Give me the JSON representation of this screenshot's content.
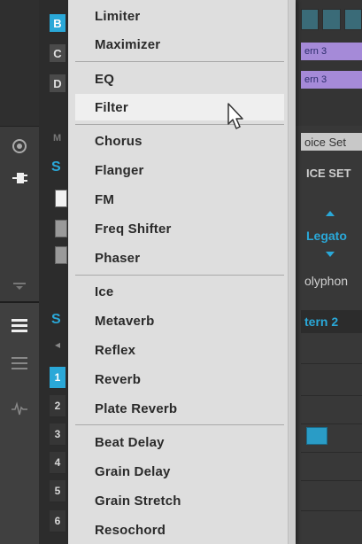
{
  "left_column": {
    "letters": [
      "B",
      "C",
      "D"
    ],
    "active_letter_index": 0,
    "group_label_1": "S",
    "group_label_2": "S",
    "section_m": "M",
    "numbers": [
      "1",
      "2",
      "3",
      "4",
      "5",
      "6"
    ],
    "active_number_index": 0
  },
  "right_panel": {
    "pattern_top_1": "ern 3",
    "pattern_top_2": "ern 3",
    "voice_field": "oice Set",
    "voice_header": "ICE SET",
    "legato": "Legato",
    "polyphony": "olyphon",
    "pattern_2": "tern 2"
  },
  "menu": {
    "groups": [
      [
        "Limiter",
        "Maximizer"
      ],
      [
        "EQ",
        "Filter"
      ],
      [
        "Chorus",
        "Flanger",
        "FM",
        "Freq Shifter",
        "Phaser"
      ],
      [
        "Ice",
        "Metaverb",
        "Reflex",
        "Reverb",
        "Plate Reverb"
      ],
      [
        "Beat Delay",
        "Grain Delay",
        "Grain Stretch",
        "Resochord"
      ]
    ],
    "hovered_item": "Filter"
  },
  "colors": {
    "accent": "#2aa8d8",
    "menu_bg": "#dedede",
    "hover_bg": "#efefef",
    "pattern_purple": "#a58ad8"
  }
}
